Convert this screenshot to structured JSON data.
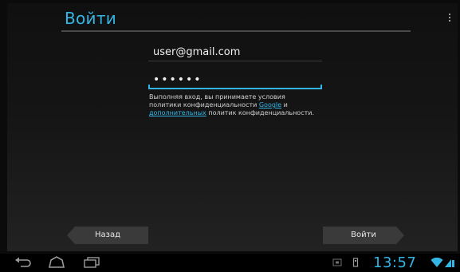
{
  "header": {
    "title": "Войти"
  },
  "form": {
    "email_value": "user@gmail.com",
    "password_value": "••••••"
  },
  "terms": {
    "text_before": "Выполняя вход, вы принимаете условия политики конфиденциальности ",
    "link_google": "Google",
    "text_and": " и ",
    "link_additional": "дополнительных",
    "text_after": " политик конфиденциальности."
  },
  "buttons": {
    "back_label": "Назад",
    "signin_label": "Войти"
  },
  "status_bar": {
    "time": "13:57"
  },
  "colors": {
    "accent": "#33b5e5",
    "button_bg": "#3a3a3a",
    "background": "#101010"
  },
  "icons": [
    "menu-overflow-icon",
    "back-nav-icon",
    "home-nav-icon",
    "recent-apps-nav-icon",
    "screenshot-icon",
    "usb-debug-icon",
    "wifi-icon",
    "battery-icon"
  ]
}
